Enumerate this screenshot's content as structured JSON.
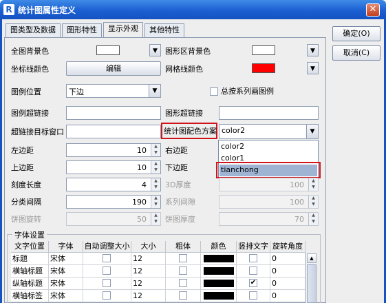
{
  "window": {
    "title": "统计图属性定义",
    "app_icon": "R"
  },
  "tabs": [
    "图类型及数据",
    "图形特性",
    "显示外观",
    "其他特性"
  ],
  "side_buttons": {
    "ok": "确定(O)",
    "cancel": "取消(C)"
  },
  "form": {
    "bg_color_label": "全图背景色",
    "plot_bg_color_label": "图形区背景色",
    "axis_color_label": "坐标线颜色",
    "edit_button": "编辑",
    "grid_color_label": "网格线颜色",
    "grid_color": "#ff0000",
    "legend_pos_label": "图例位置",
    "legend_pos_value": "下边",
    "legend_by_series_label": "总按系列画图例",
    "legend_link_label": "图例超链接",
    "chart_link_label": "图形超链接",
    "link_target_label": "超链接目标窗口",
    "color_scheme_label": "统计图配色方案",
    "color_scheme_value": "color2",
    "color_scheme_options": [
      "color2",
      "color1",
      "tianchong"
    ],
    "left_margin_label": "左边距",
    "left_margin": "10",
    "right_margin_label": "右边距",
    "top_margin_label": "上边距",
    "top_margin": "10",
    "bottom_margin_label": "下边距",
    "tick_len_label": "刻度长度",
    "tick_len": "4",
    "depth3d_label": "3D厚度",
    "depth3d": "100",
    "cat_gap_label": "分类间隔",
    "cat_gap": "190",
    "series_gap_label": "系列间隙",
    "series_gap": "100",
    "pie_rotate_label": "饼图旋转",
    "pie_rotate": "50",
    "pie_height_label": "饼图厚度",
    "pie_height": "70"
  },
  "font_settings": {
    "title": "字体设置",
    "headers": [
      "文字位置",
      "字体",
      "自动调整大小",
      "大小",
      "粗体",
      "颜色",
      "竖排文字",
      "旋转角度"
    ],
    "rows": [
      {
        "pos": "标题",
        "font": "宋体",
        "size": "12",
        "vertical": false,
        "angle": "0"
      },
      {
        "pos": "横轴标题",
        "font": "宋体",
        "size": "12",
        "vertical": false,
        "angle": "0"
      },
      {
        "pos": "纵轴标题",
        "font": "宋体",
        "size": "12",
        "vertical": true,
        "angle": "0"
      },
      {
        "pos": "横轴标签",
        "font": "宋体",
        "size": "12",
        "vertical": false,
        "angle": "0"
      }
    ]
  }
}
